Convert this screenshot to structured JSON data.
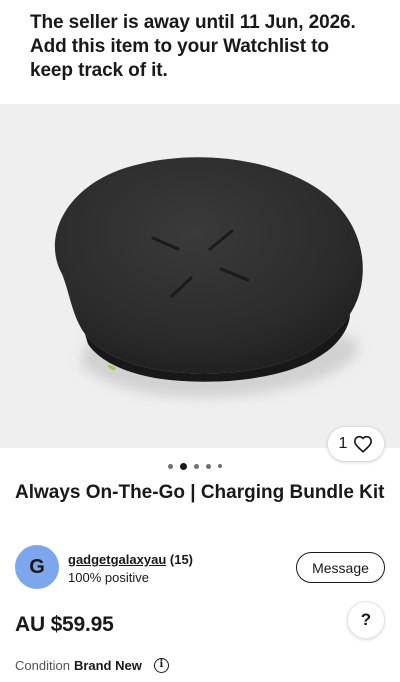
{
  "notice": {
    "line1": "The seller is away until 11 Jun, 2026.",
    "line2": "Add this item to your Watchlist to",
    "line3": "keep track of it."
  },
  "gallery": {
    "watch_count": "1",
    "watch_icon": "heart-outline-icon",
    "image_count": 5,
    "active_index": 1,
    "product_image": "black wireless charging pad"
  },
  "item": {
    "title": "Always On-The-Go | Charging Bundle Kit"
  },
  "seller": {
    "avatar_letter": "G",
    "avatar_color": "#7da7ed",
    "name": "gadgetgalaxyau",
    "feedback": "(15)",
    "positive": "100% positive",
    "message_label": "Message"
  },
  "pricing": {
    "price": "AU $59.95",
    "help_label": "?"
  },
  "condition": {
    "label": "Condition",
    "value": "Brand New",
    "info_icon": "info-icon"
  }
}
